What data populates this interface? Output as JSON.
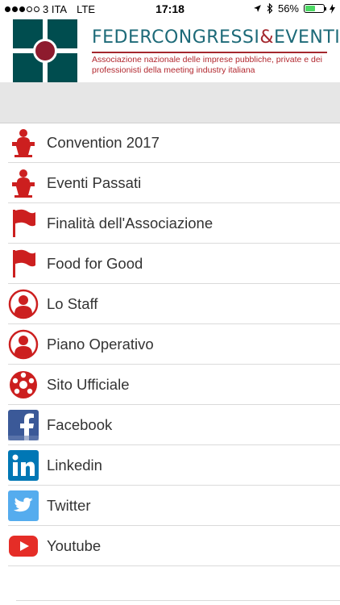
{
  "status_bar": {
    "carrier": "3 ITA",
    "network": "LTE",
    "time": "17:18",
    "battery": "56%",
    "battery_level": 0.56,
    "signal_bars": 3,
    "icons": [
      "location-icon",
      "bluetooth-icon",
      "battery-icon",
      "charging-icon"
    ]
  },
  "header": {
    "brand_part1": "FEDERCONGRESSI",
    "brand_amp": "&",
    "brand_part2": "EVENTI",
    "subtitle": "Associazione nazionale delle imprese pubbliche, private e dei professionisti della meeting industry italiana"
  },
  "menu": {
    "items": [
      {
        "label": "Convention 2017",
        "icon": "podium-icon"
      },
      {
        "label": "Eventi Passati",
        "icon": "podium-icon"
      },
      {
        "label": "Finalità dell'Associazione",
        "icon": "flag-icon"
      },
      {
        "label": "Food for Good",
        "icon": "flag-icon"
      },
      {
        "label": "Lo Staff",
        "icon": "person-icon"
      },
      {
        "label": "Piano Operativo",
        "icon": "person-icon"
      },
      {
        "label": "Sito Ufficiale",
        "icon": "globe-icon"
      },
      {
        "label": "Facebook",
        "icon": "facebook-icon"
      },
      {
        "label": "Linkedin",
        "icon": "linkedin-icon"
      },
      {
        "label": "Twitter",
        "icon": "twitter-icon"
      },
      {
        "label": "Youtube",
        "icon": "youtube-icon"
      }
    ]
  },
  "colors": {
    "brand_teal": "#004d4f",
    "brand_red": "#a4282e",
    "icon_red": "#cc1f1f",
    "facebook": "#3b5998",
    "linkedin": "#0077b5",
    "twitter": "#55acee",
    "youtube": "#e52d27"
  }
}
